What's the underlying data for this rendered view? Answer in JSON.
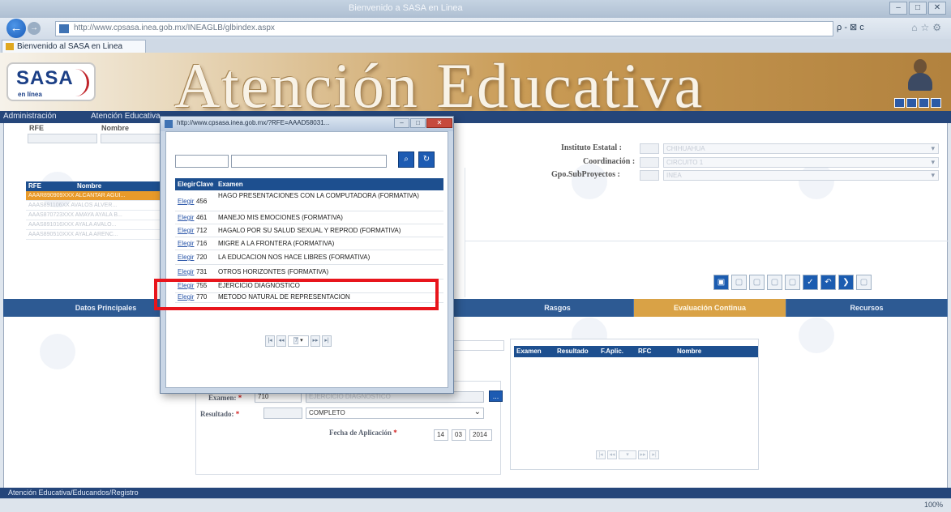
{
  "browser": {
    "window_title": "Bienvenido a SASA en Linea",
    "url": "http://www.cpsasa.inea.gob.mx/INEAGLB/glbindex.aspx",
    "tab_label": "Bienvenido al SASA en Linea",
    "url_tools": "ρ - ⊠ c",
    "zoom": "100%"
  },
  "banner": {
    "logo_text": "SASA",
    "logo_sub": "en línea",
    "title": "Atención Educativa"
  },
  "menubar": {
    "item1": "Administración",
    "item2": "Atención Educativa"
  },
  "search": {
    "rfe_label": "RFE",
    "nombre_label": "Nombre"
  },
  "grid": {
    "col1": "RFE",
    "col2": "Nombre",
    "rows": [
      "AAAR890909XXX  ALCANTAR AGUI...",
      "AAAS891106XX  AVALOS ALVER...",
      "AAAS870723XXX  AMAYA AYALA B...",
      "AAAS891016XXX  AYALA AVALO...",
      "AAAS890510XXX  AYALA ARENC..."
    ]
  },
  "right_fields": {
    "instituto_label": "Instituto Estatal :",
    "coordinacion_label": "Coordinación :",
    "gpo_label": "Gpo.SubProyectos :",
    "instituto_value": "CHIHUAHUA",
    "coordinacion_value": "CIRCUITO 1",
    "gpo_value": "INEA"
  },
  "navtabs": {
    "t1": "Datos Principales",
    "t2": "Rasgos",
    "t3": "Evaluación Continua",
    "t4": "Recursos"
  },
  "form": {
    "examen_label": "Examen:",
    "examen_value": "710",
    "examen_desc": "EJERCICIO DIAGNOSTICO",
    "ellipsis": "...",
    "resultado_label": "Resultado:",
    "resultado_value": "COMPLETO",
    "fecha_label": "Fecha de Aplicación",
    "fecha_dd": "14",
    "fecha_mm": "03",
    "fecha_yyyy": "2014",
    "req_star": "*"
  },
  "results_table": {
    "h1": "Examen",
    "h2": "Resultado",
    "h3": "F.Aplic.",
    "h4": "RFC",
    "h5": "Nombre"
  },
  "statusbar": {
    "text": "Atención Educativa/Educandos/Registro"
  },
  "popup": {
    "title": "http://www.cpsasa.inea.gob.mx/?RFE=AAAD58031...",
    "headers": {
      "c1": "Elegir",
      "c2": "Clave",
      "c3": "Examen"
    },
    "rows": [
      {
        "action": "Elegir",
        "clave": "456",
        "examen": "HAGO PRESENTACIONES CON LA COMPUTADORA (FORMATIVA)"
      },
      {
        "action": "Elegir",
        "clave": "461",
        "examen": "MANEJO MIS EMOCIONES (FORMATIVA)"
      },
      {
        "action": "Elegir",
        "clave": "712",
        "examen": "HAGALO POR SU SALUD SEXUAL Y REPROD (FORMATIVA)"
      },
      {
        "action": "Elegir",
        "clave": "716",
        "examen": "MIGRE A LA FRONTERA (FORMATIVA)"
      },
      {
        "action": "Elegir",
        "clave": "720",
        "examen": "LA EDUCACION NOS HACE LIBRES (FORMATIVA)"
      },
      {
        "action": "Elegir",
        "clave": "731",
        "examen": "OTROS HORIZONTES (FORMATIVA)"
      },
      {
        "action": "Elegir",
        "clave": "755",
        "examen": "EJERCICIO DIAGNOSTICO"
      },
      {
        "action": "Elegir",
        "clave": "770",
        "examen": "METODO NATURAL DE REPRESENTACION"
      }
    ],
    "page_value": "7"
  }
}
